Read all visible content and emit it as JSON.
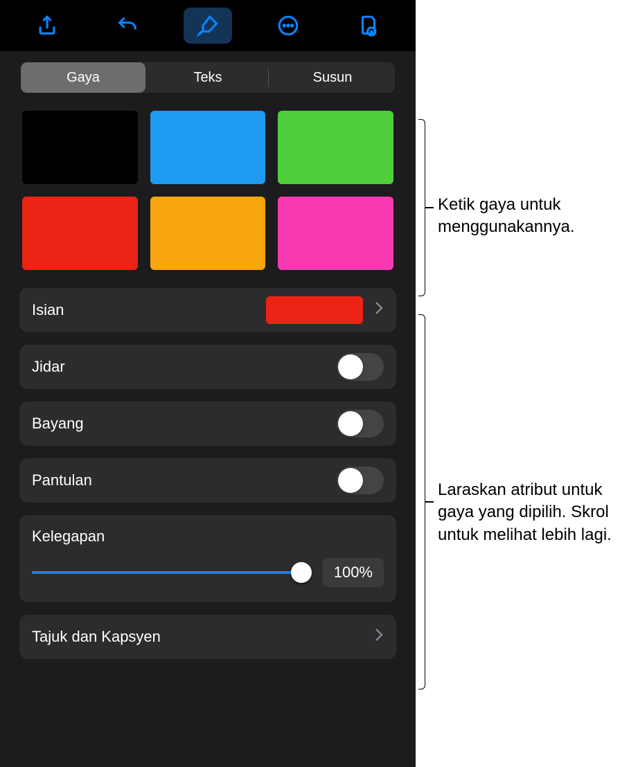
{
  "toolbar": {
    "icons": [
      "share-icon",
      "undo-icon",
      "format-brush-icon",
      "more-icon",
      "document-view-icon"
    ],
    "active_index": 2
  },
  "tabs": {
    "items": [
      "Gaya",
      "Teks",
      "Susun"
    ],
    "selected_index": 0
  },
  "styles": {
    "swatches": [
      {
        "color": "#000000"
      },
      {
        "color": "#1e9af0"
      },
      {
        "color": "#4fcf3c"
      },
      {
        "color": "#ed2415"
      },
      {
        "color": "#f7a60d"
      },
      {
        "color": "#f73ab2"
      }
    ]
  },
  "rows": {
    "fill": {
      "label": "Isian",
      "swatch_color": "#ed2415"
    },
    "border": {
      "label": "Jidar",
      "on": false
    },
    "shadow": {
      "label": "Bayang",
      "on": false
    },
    "reflection": {
      "label": "Pantulan",
      "on": false
    },
    "opacity": {
      "label": "Kelegapan",
      "value": "100%",
      "percent": 100
    },
    "title_caption": {
      "label": "Tajuk dan Kapsyen"
    }
  },
  "callouts": {
    "styles_text": "Ketik gaya untuk menggunakannya.",
    "attrs_text": "Laraskan atribut untuk gaya yang dipilih. Skrol untuk melihat lebih lagi."
  }
}
